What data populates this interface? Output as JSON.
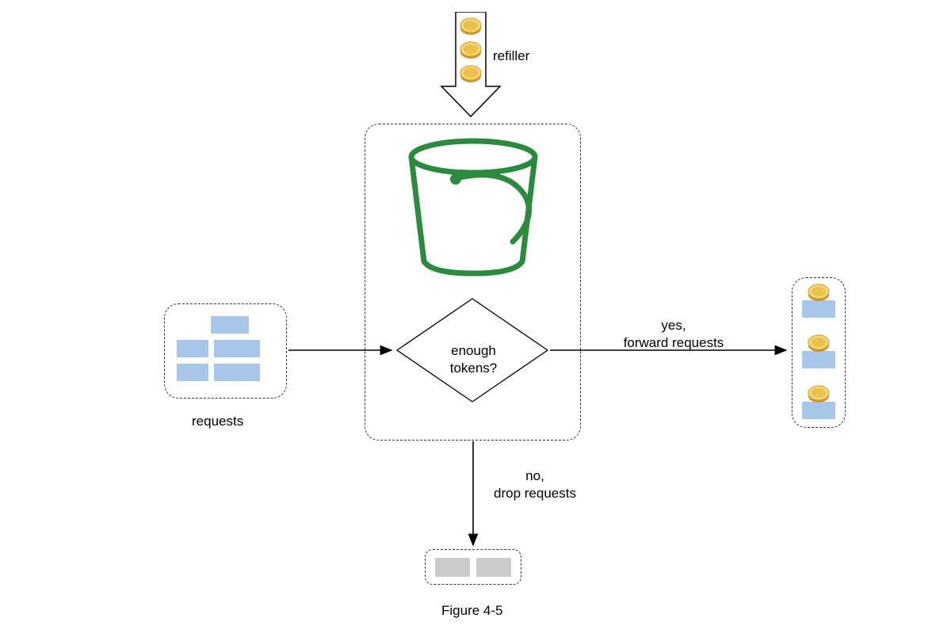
{
  "labels": {
    "refiller": "refiller",
    "requests": "requests",
    "figure": "Figure 4-5",
    "decision": "enough tokens?",
    "yes_line": "yes,",
    "yes_sub": "forward requests",
    "no_line": "no,",
    "no_sub": "drop requests"
  }
}
